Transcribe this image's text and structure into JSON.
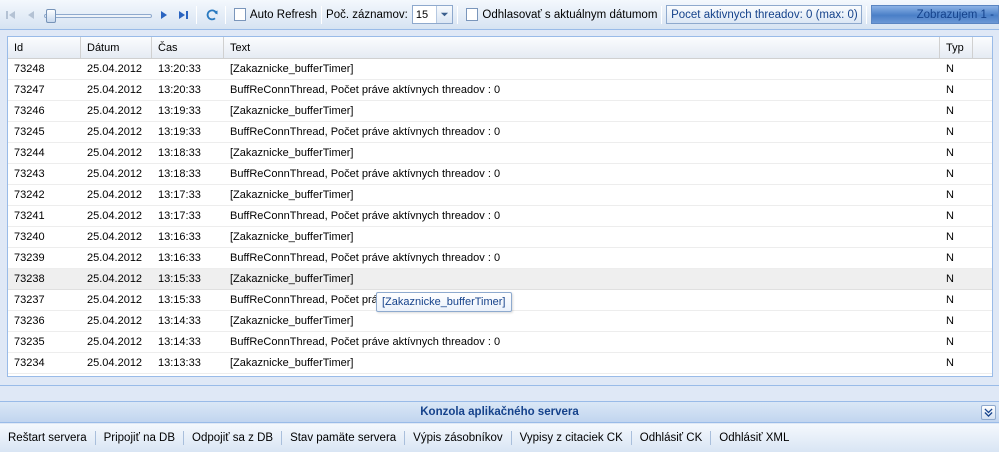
{
  "toolbar": {
    "auto_refresh_label": "Auto Refresh",
    "records_label": "Poč. záznamov:",
    "records_value": "15",
    "logout_label": "Odhlasovať s aktuálnym dátumom",
    "threads_status": "Pocet aktivnych threadov: 0 (max: 0)",
    "display_status": "Zobrazujem 1 -",
    "icons": [
      "first-page-icon",
      "prev-page-icon",
      "next-page-icon",
      "last-page-icon",
      "refresh-icon",
      "chevron-down-icon"
    ]
  },
  "grid": {
    "columns": [
      "Id",
      "Dátum",
      "Čas",
      "Text",
      "Typ"
    ],
    "rows": [
      {
        "id": "73248",
        "date": "25.04.2012",
        "time": "13:20:33",
        "text": "[Zakaznicke_bufferTimer]",
        "typ": "N"
      },
      {
        "id": "73247",
        "date": "25.04.2012",
        "time": "13:20:33",
        "text": "BuffReConnThread, Počet práve aktívnych threadov : 0",
        "typ": "N"
      },
      {
        "id": "73246",
        "date": "25.04.2012",
        "time": "13:19:33",
        "text": "[Zakaznicke_bufferTimer]",
        "typ": "N"
      },
      {
        "id": "73245",
        "date": "25.04.2012",
        "time": "13:19:33",
        "text": "BuffReConnThread, Počet práve aktívnych threadov : 0",
        "typ": "N"
      },
      {
        "id": "73244",
        "date": "25.04.2012",
        "time": "13:18:33",
        "text": "[Zakaznicke_bufferTimer]",
        "typ": "N"
      },
      {
        "id": "73243",
        "date": "25.04.2012",
        "time": "13:18:33",
        "text": "BuffReConnThread, Počet práve aktívnych threadov : 0",
        "typ": "N"
      },
      {
        "id": "73242",
        "date": "25.04.2012",
        "time": "13:17:33",
        "text": "[Zakaznicke_bufferTimer]",
        "typ": "N"
      },
      {
        "id": "73241",
        "date": "25.04.2012",
        "time": "13:17:33",
        "text": "BuffReConnThread, Počet práve aktívnych threadov : 0",
        "typ": "N"
      },
      {
        "id": "73240",
        "date": "25.04.2012",
        "time": "13:16:33",
        "text": "[Zakaznicke_bufferTimer]",
        "typ": "N"
      },
      {
        "id": "73239",
        "date": "25.04.2012",
        "time": "13:16:33",
        "text": "BuffReConnThread, Počet práve aktívnych threadov : 0",
        "typ": "N"
      },
      {
        "id": "73238",
        "date": "25.04.2012",
        "time": "13:15:33",
        "text": "[Zakaznicke_bufferTimer]",
        "typ": "N"
      },
      {
        "id": "73237",
        "date": "25.04.2012",
        "time": "13:15:33",
        "text": "BuffReConnThread, Počet práv",
        "typ": "N"
      },
      {
        "id": "73236",
        "date": "25.04.2012",
        "time": "13:14:33",
        "text": "[Zakaznicke_bufferTimer]",
        "typ": "N"
      },
      {
        "id": "73235",
        "date": "25.04.2012",
        "time": "13:14:33",
        "text": "BuffReConnThread, Počet práve aktívnych threadov : 0",
        "typ": "N"
      },
      {
        "id": "73234",
        "date": "25.04.2012",
        "time": "13:13:33",
        "text": "[Zakaznicke_bufferTimer]",
        "typ": "N"
      }
    ],
    "hover_row_index": 10
  },
  "tooltip": {
    "text": "[Zakaznicke_bufferTimer]"
  },
  "console": {
    "title": "Konzola aplikačného servera",
    "buttons": [
      "Reštart servera",
      "Pripojiť na DB",
      "Odpojiť sa z DB",
      "Stav pamäte servera",
      "Výpis zásobníkov",
      "Vypisy z citaciek CK",
      "Odhlásiť CK",
      "Odhlásiť XML"
    ]
  },
  "colors": {
    "accent": "#15428b",
    "border": "#99bbe8",
    "panel_bg": "#dfe8f6"
  }
}
